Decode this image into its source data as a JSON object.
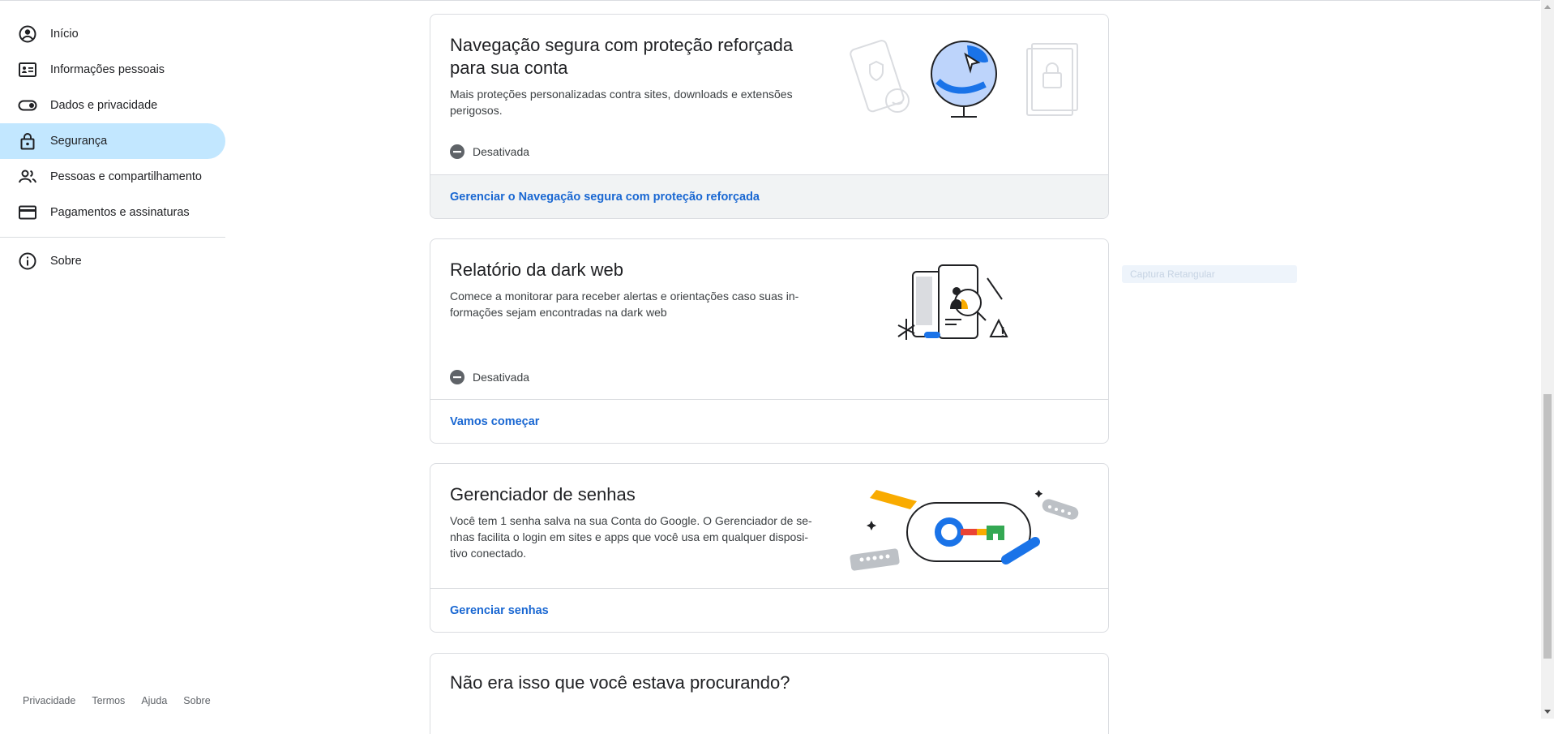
{
  "sidebar": {
    "items": [
      {
        "label": "Início",
        "icon": "account-circle-icon"
      },
      {
        "label": "Informações pessoais",
        "icon": "id-card-icon"
      },
      {
        "label": "Dados e privacidade",
        "icon": "toggle-icon"
      },
      {
        "label": "Segurança",
        "icon": "lock-icon",
        "active": true
      },
      {
        "label": "Pessoas e compartilhamento",
        "icon": "people-icon"
      },
      {
        "label": "Pagamentos e assinaturas",
        "icon": "credit-card-icon"
      }
    ],
    "about": {
      "label": "Sobre",
      "icon": "info-icon"
    }
  },
  "footer": {
    "links": [
      "Privacidade",
      "Termos",
      "Ajuda",
      "Sobre"
    ]
  },
  "cards": [
    {
      "title_line1": "Navegação segura com proteção reforçada",
      "title_line2": "para sua conta",
      "desc_line1": "Mais proteções personalizadas contra sites, downloads e extensões",
      "desc_line2": "perigosos.",
      "status": "Desativada",
      "link": "Gerenciar o Navegação segura com proteção reforçada"
    },
    {
      "title": "Relatório da dark web",
      "desc_line1": "Comece a monitorar para receber alertas e orientações caso suas in-",
      "desc_line2": "formações sejam encontradas na dark web",
      "status": "Desativada",
      "link": "Vamos começar"
    },
    {
      "title": "Gerenciador de senhas",
      "desc_line1": "Você tem 1 senha salva na sua Conta do Google. O Gerenciador de se-",
      "desc_line2": "nhas facilita o login em sites e apps que você usa em qualquer disposi-",
      "desc_line3": "tivo conectado.",
      "link": "Gerenciar senhas"
    },
    {
      "title": "Não era isso que você estava procurando?"
    }
  ],
  "overlay": {
    "label": "Captura Retangular"
  },
  "colors": {
    "accent": "#1967d2",
    "active_nav": "#c2e7ff",
    "border": "#dadce0"
  }
}
